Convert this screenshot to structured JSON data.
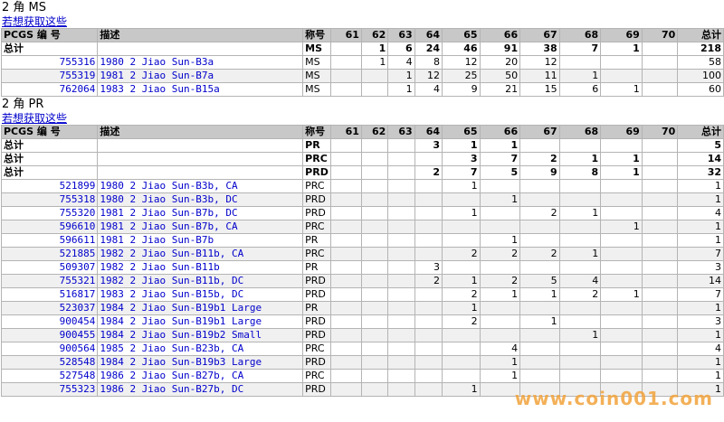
{
  "sections": [
    {
      "title": "2 角 MS",
      "link": "若想获取这些",
      "header": [
        "PCGS 编 号",
        "描述",
        "称号",
        "61",
        "62",
        "63",
        "64",
        "65",
        "66",
        "67",
        "68",
        "69",
        "70",
        "总计"
      ],
      "totals": [
        {
          "label": "总计",
          "desig": "MS",
          "g": [
            "",
            "1",
            "6",
            "24",
            "46",
            "91",
            "38",
            "7",
            "1",
            ""
          ],
          "total": "218"
        }
      ],
      "rows": [
        {
          "pcgs": "755316",
          "desc": "1980 2 Jiao Sun-B3a",
          "desig": "MS",
          "g": [
            "",
            "1",
            "4",
            "8",
            "12",
            "20",
            "12",
            "",
            "",
            ""
          ],
          "total": "58"
        },
        {
          "pcgs": "755319",
          "desc": "1981 2 Jiao Sun-B7a",
          "desig": "MS",
          "g": [
            "",
            "",
            "1",
            "12",
            "25",
            "50",
            "11",
            "1",
            "",
            ""
          ],
          "total": "100"
        },
        {
          "pcgs": "762064",
          "desc": "1983 2 Jiao Sun-B15a",
          "desig": "MS",
          "g": [
            "",
            "",
            "1",
            "4",
            "9",
            "21",
            "15",
            "6",
            "1",
            ""
          ],
          "total": "60"
        }
      ]
    },
    {
      "title": "2 角 PR",
      "link": "若想获取这些",
      "header": [
        "PCGS 编 号",
        "描述",
        "称号",
        "61",
        "62",
        "63",
        "64",
        "65",
        "66",
        "67",
        "68",
        "69",
        "70",
        "总计"
      ],
      "totals": [
        {
          "label": "总计",
          "desig": "PR",
          "g": [
            "",
            "",
            "",
            "3",
            "1",
            "1",
            "",
            "",
            "",
            ""
          ],
          "total": "5"
        },
        {
          "label": "总计",
          "desig": "PRC",
          "g": [
            "",
            "",
            "",
            "",
            "3",
            "7",
            "2",
            "1",
            "1",
            ""
          ],
          "total": "14"
        },
        {
          "label": "总计",
          "desig": "PRD",
          "g": [
            "",
            "",
            "",
            "2",
            "7",
            "5",
            "9",
            "8",
            "1",
            ""
          ],
          "total": "32"
        }
      ],
      "rows": [
        {
          "pcgs": "521899",
          "desc": "1980 2 Jiao Sun-B3b, CA",
          "desig": "PRC",
          "g": [
            "",
            "",
            "",
            "",
            "1",
            "",
            "",
            "",
            "",
            ""
          ],
          "total": "1"
        },
        {
          "pcgs": "755318",
          "desc": "1980 2 Jiao Sun-B3b, DC",
          "desig": "PRD",
          "g": [
            "",
            "",
            "",
            "",
            "",
            "1",
            "",
            "",
            "",
            ""
          ],
          "total": "1"
        },
        {
          "pcgs": "755320",
          "desc": "1981 2 Jiao Sun-B7b, DC",
          "desig": "PRD",
          "g": [
            "",
            "",
            "",
            "",
            "1",
            "",
            "2",
            "1",
            "",
            ""
          ],
          "total": "4"
        },
        {
          "pcgs": "596610",
          "desc": "1981 2 Jiao Sun-B7b, CA",
          "desig": "PRC",
          "g": [
            "",
            "",
            "",
            "",
            "",
            "",
            "",
            "",
            "1",
            ""
          ],
          "total": "1"
        },
        {
          "pcgs": "596611",
          "desc": "1981 2 Jiao Sun-B7b",
          "desig": "PR",
          "g": [
            "",
            "",
            "",
            "",
            "",
            "1",
            "",
            "",
            "",
            ""
          ],
          "total": "1"
        },
        {
          "pcgs": "521885",
          "desc": "1982 2 Jiao Sun-B11b, CA",
          "desig": "PRC",
          "g": [
            "",
            "",
            "",
            "",
            "2",
            "2",
            "2",
            "1",
            "",
            ""
          ],
          "total": "7"
        },
        {
          "pcgs": "509307",
          "desc": "1982 2 Jiao Sun-B11b",
          "desig": "PR",
          "g": [
            "",
            "",
            "",
            "3",
            "",
            "",
            "",
            "",
            "",
            ""
          ],
          "total": "3"
        },
        {
          "pcgs": "755321",
          "desc": "1982 2 Jiao Sun-B11b, DC",
          "desig": "PRD",
          "g": [
            "",
            "",
            "",
            "2",
            "1",
            "2",
            "5",
            "4",
            "",
            ""
          ],
          "total": "14"
        },
        {
          "pcgs": "516817",
          "desc": "1983 2 Jiao Sun-B15b, DC",
          "desig": "PRD",
          "g": [
            "",
            "",
            "",
            "",
            "2",
            "1",
            "1",
            "2",
            "1",
            ""
          ],
          "total": "7"
        },
        {
          "pcgs": "523037",
          "desc": "1984 2 Jiao Sun-B19b1 Large",
          "desig": "PR",
          "g": [
            "",
            "",
            "",
            "",
            "1",
            "",
            "",
            "",
            "",
            ""
          ],
          "total": "1"
        },
        {
          "pcgs": "900454",
          "desc": "1984 2 Jiao Sun-B19b1 Large",
          "desig": "PRD",
          "g": [
            "",
            "",
            "",
            "",
            "2",
            "",
            "1",
            "",
            "",
            ""
          ],
          "total": "3"
        },
        {
          "pcgs": "900455",
          "desc": "1984 2 Jiao Sun-B19b2 Small",
          "desig": "PRD",
          "g": [
            "",
            "",
            "",
            "",
            "",
            "",
            "",
            "1",
            "",
            ""
          ],
          "total": "1"
        },
        {
          "pcgs": "900564",
          "desc": "1985 2 Jiao Sun-B23b, CA",
          "desig": "PRC",
          "g": [
            "",
            "",
            "",
            "",
            "",
            "4",
            "",
            "",
            "",
            ""
          ],
          "total": "4"
        },
        {
          "pcgs": "528548",
          "desc": "1984 2 Jiao Sun-B19b3 Large",
          "desig": "PRD",
          "g": [
            "",
            "",
            "",
            "",
            "",
            "1",
            "",
            "",
            "",
            ""
          ],
          "total": "1"
        },
        {
          "pcgs": "527548",
          "desc": "1986 2 Jiao Sun-B27b, CA",
          "desig": "PRC",
          "g": [
            "",
            "",
            "",
            "",
            "",
            "1",
            "",
            "",
            "",
            ""
          ],
          "total": "1"
        },
        {
          "pcgs": "755323",
          "desc": "1986 2 Jiao Sun-B27b, DC",
          "desig": "PRD",
          "g": [
            "",
            "",
            "",
            "",
            "1",
            "",
            "",
            "",
            "",
            ""
          ],
          "total": "1"
        }
      ]
    }
  ],
  "watermark": "www.coin001.com"
}
